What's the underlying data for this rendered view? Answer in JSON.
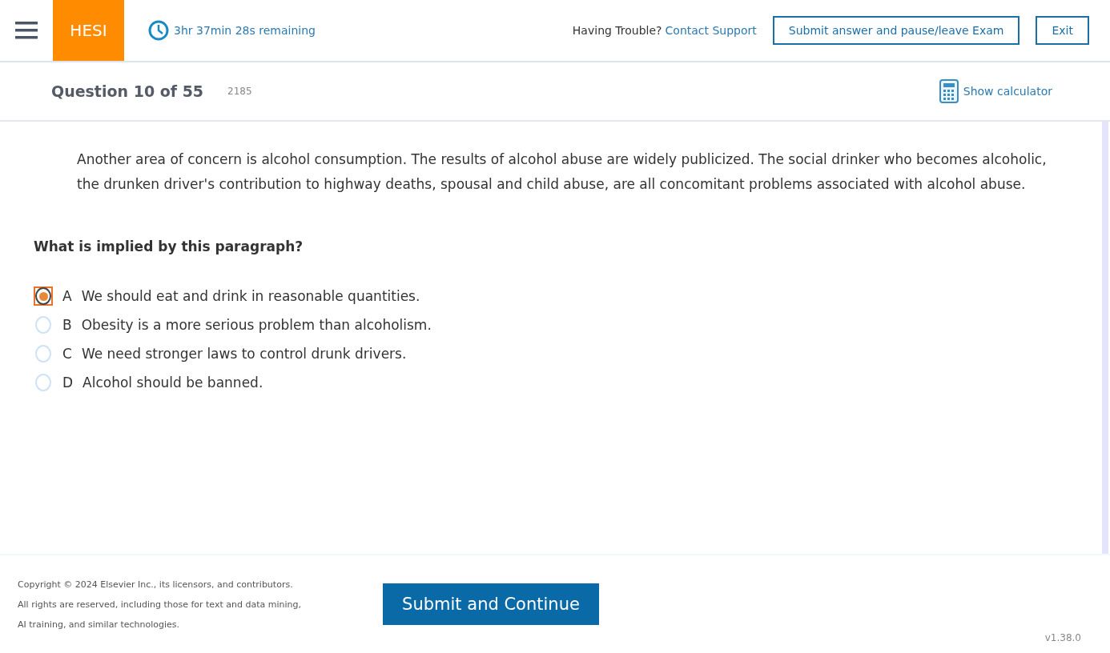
{
  "header": {
    "logo": "HESI",
    "timer": "3hr 37min 28s remaining",
    "help_text": "Having Trouble?",
    "help_link": "Contact Support",
    "pause_button": "Submit answer and pause/leave Exam",
    "exit_button": "Exit"
  },
  "question_bar": {
    "title": "Question 10 of 55",
    "code": "2185",
    "calculator_link": "Show calculator"
  },
  "passage": "Another area of concern is alcohol consumption.  The results of alcohol abuse are widely publicized.  The social drinker who becomes alcoholic, the drunken driver's contribution to highway deaths, spousal and child abuse, are all concomitant problems associated with alcohol abuse.",
  "prompt": "What is implied by this paragraph?",
  "options": [
    {
      "letter": "A",
      "text": "We should eat and drink in reasonable quantities.",
      "selected": true
    },
    {
      "letter": "B",
      "text": "Obesity is a more serious problem than alcoholism.",
      "selected": false
    },
    {
      "letter": "C",
      "text": "We need stronger laws to control drunk drivers.",
      "selected": false
    },
    {
      "letter": "D",
      "text": "Alcohol should be banned.",
      "selected": false
    }
  ],
  "footer": {
    "copyright": "Copyright © 2024 Elsevier Inc., its licensors, and contributors. All rights are reserved, including those for text and data mining, AI training, and similar technologies.",
    "submit_button": "Submit and Continue",
    "version": "v1.38.0"
  }
}
